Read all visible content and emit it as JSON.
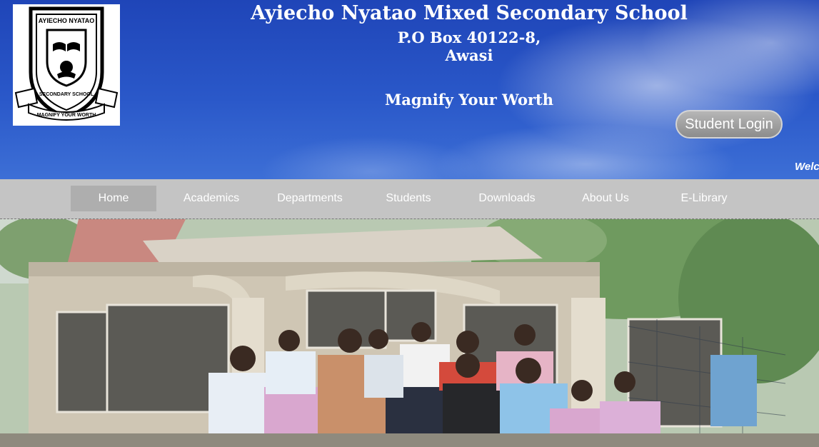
{
  "header": {
    "school_name": "Ayiecho Nyatao Mixed Secondary School",
    "address_line1": "P.O Box 40122-8,",
    "address_line2": "Awasi",
    "motto": "Magnify Your Worth",
    "login_label": "Student Login",
    "marquee_text": "Welco"
  },
  "logo": {
    "top_text": "AYIECHO NYATAO",
    "bottom_text": "SECONDARY SCHOOL",
    "ribbon_text": "MAGNIFY YOUR WORTH"
  },
  "nav": {
    "items": [
      {
        "label": "Home",
        "active": true
      },
      {
        "label": "Academics",
        "active": false
      },
      {
        "label": "Departments",
        "active": false
      },
      {
        "label": "Students",
        "active": false
      },
      {
        "label": "Downloads",
        "active": false
      },
      {
        "label": "About Us",
        "active": false
      },
      {
        "label": "E-Library",
        "active": false
      }
    ]
  },
  "colors": {
    "header_blue": "#2a58c9",
    "nav_bg": "#c4c4c4",
    "nav_active": "#aeaeae",
    "login_button": "#9e9e9e"
  }
}
